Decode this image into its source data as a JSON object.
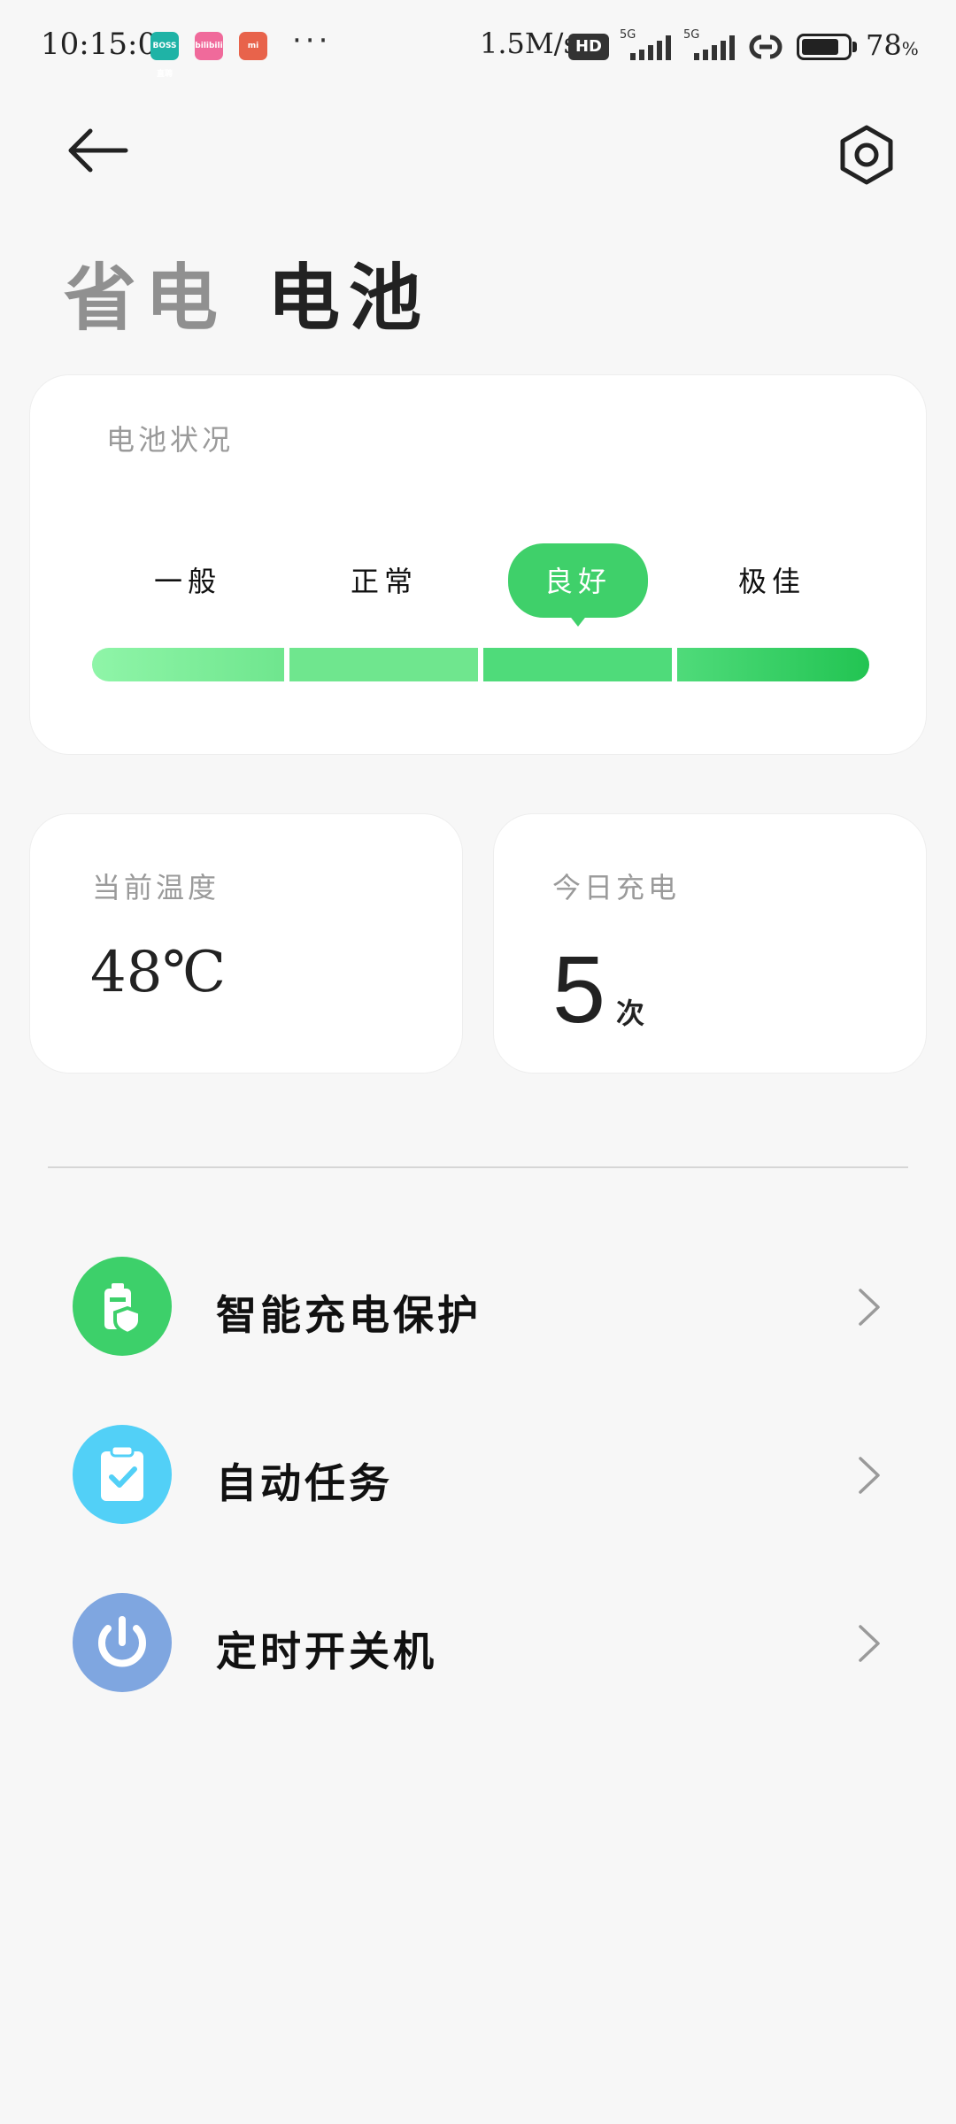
{
  "status_bar": {
    "time": "10:15:05",
    "notification_icons": [
      {
        "name": "boss-zhipin-app-icon",
        "label": "BOSS 直聘",
        "color": "#1fb3a6"
      },
      {
        "name": "bilibili-app-icon",
        "label": "bilibili",
        "color": "#f06a9b"
      },
      {
        "name": "mi-app-icon",
        "label": "mi",
        "color": "#e8634b"
      }
    ],
    "more": "···",
    "net_speed": "1.5M/s",
    "hd_badge": "HD",
    "signal_1_label": "5G",
    "signal_2_label": "5G",
    "battery_percent": "78",
    "battery_unit": "%",
    "battery_level": 0.78
  },
  "header": {
    "back_icon": "arrow-left-icon",
    "settings_icon": "gear-icon",
    "title_inactive": "省电",
    "title_active": "电池"
  },
  "battery_status": {
    "label": "电池状况",
    "levels": [
      "一般",
      "正常",
      "良好",
      "极佳"
    ],
    "selected_index": 2,
    "bar_colors": [
      "#8ff5a8",
      "#6fe68e",
      "#4fdb7a",
      "#22c452"
    ]
  },
  "temperature": {
    "label": "当前温度",
    "value": "48℃"
  },
  "charging": {
    "label": "今日充电",
    "count": "5",
    "unit": "次"
  },
  "menu": [
    {
      "label": "智能充电保护",
      "icon": "battery-shield-icon",
      "color": "#3dd06a"
    },
    {
      "label": "自动任务",
      "icon": "clipboard-check-icon",
      "color": "#52d0f7"
    },
    {
      "label": "定时开关机",
      "icon": "power-icon",
      "color": "#7fa6e0"
    }
  ]
}
